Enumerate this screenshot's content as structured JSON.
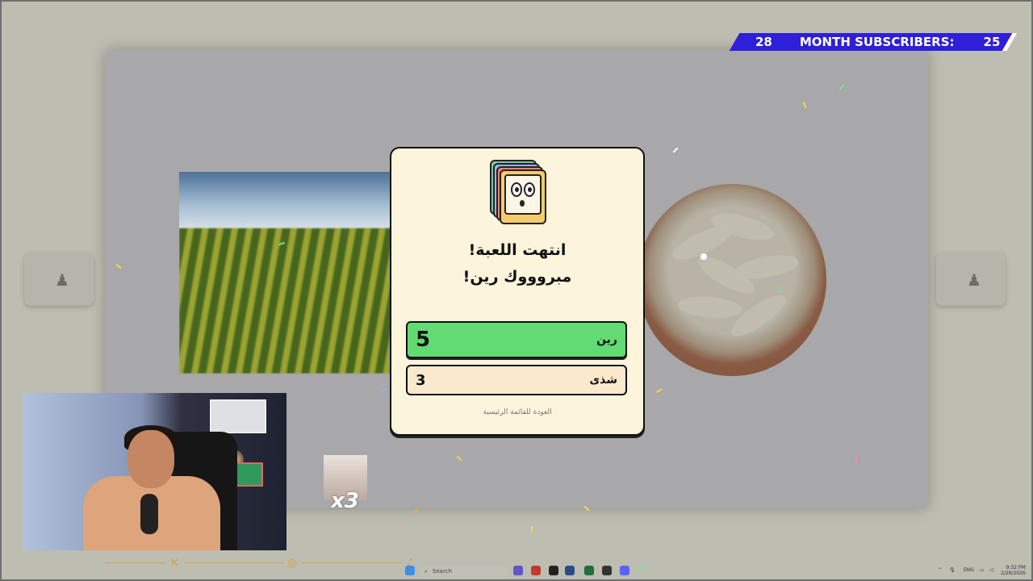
{
  "subscribers_bar": {
    "left_count": "28",
    "label": "MONTH SUBSCRIBERS:",
    "right_count": "25"
  },
  "modal": {
    "title_line1": "انتهت اللعبة!",
    "title_line2": "مبروووك رين!",
    "scores": [
      {
        "name": "رين",
        "score": "5",
        "winner": true
      },
      {
        "name": "شذى",
        "score": "3",
        "winner": false
      }
    ],
    "back_link": "العودة للقائمة الرئيسية"
  },
  "sticker": {
    "multiplier": "x3"
  },
  "taskbar": {
    "search_placeholder": "Search",
    "language": "ENG",
    "time": "9:32 PM",
    "date": "2/28/2026"
  },
  "colors": {
    "winner_row": "#62dc72",
    "loser_row": "#fbe9cd",
    "modal_bg": "#fdf4dc",
    "subs_bar": "#2f1fd9"
  }
}
